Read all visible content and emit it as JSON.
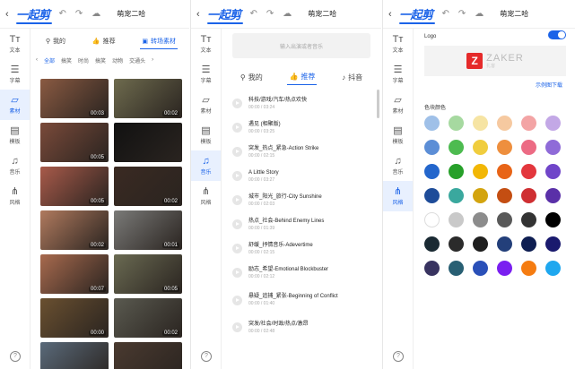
{
  "common": {
    "app_logo": "一起剪",
    "title": "萌宠二哈",
    "sidebar": [
      "文本",
      "字幕",
      "素材",
      "模板",
      "音乐",
      "风格"
    ]
  },
  "material_panel": {
    "tabs": [
      "我的",
      "推荐",
      "转场素材"
    ],
    "subtabs": [
      "全部",
      "搞笑",
      "时尚",
      "搞笑",
      "动物",
      "交通头"
    ],
    "durations": [
      "00:03",
      "00:02",
      "00:05",
      "",
      "00:05",
      "00:02",
      "00:02",
      "00:01",
      "00:07",
      "00:05",
      "00:00",
      "00:02",
      "",
      ""
    ]
  },
  "music_panel": {
    "search_placeholder": "输入出演或者音乐",
    "tabs": [
      "我的",
      "推荐",
      "抖音"
    ],
    "tracks": [
      {
        "name": "科技/游戏/汽车/热点欢快",
        "time": "00:00 / 03:24"
      },
      {
        "name": "遇见 (相聚版)",
        "time": "00:00 / 03:25"
      },
      {
        "name": "突发_热点_紧急-Action Strike",
        "time": "00:00 / 02:15"
      },
      {
        "name": "A Little Story",
        "time": "00:00 / 03:27"
      },
      {
        "name": "城市_阳光_旅行-City Sunshine",
        "time": "00:00 / 02:03"
      },
      {
        "name": "热点_社会-Behind Enemy Lines",
        "time": "00:00 / 01:39"
      },
      {
        "name": "舒缓_抒情音乐-Adevertime",
        "time": "00:00 / 02:15"
      },
      {
        "name": "励志_希望-Emotional Blockbuster",
        "time": "00:00 / 02:12"
      },
      {
        "name": "悬疑_追捕_紧张-Beginning of Conflict",
        "time": "00:00 / 01:40"
      },
      {
        "name": "突发/社会/时政/热点/激昂",
        "time": "00:00 / 02:48"
      }
    ]
  },
  "style_panel": {
    "logo_label": "Logo",
    "logo_name": "ZAKER",
    "logo_sub": "扎客",
    "logo_link": "示例图下载",
    "color_label": "色块颜色",
    "colors": [
      [
        "#9fc0e8",
        "#a6d9a0",
        "#f6e4a3",
        "#f6c9a0",
        "#f3a4a5",
        "#c3a8e6"
      ],
      [
        "#5c8ed6",
        "#4dbb50",
        "#f0cd3e",
        "#ee8f3e",
        "#ec6b84",
        "#8f6bd8"
      ],
      [
        "#2366cc",
        "#27a02a",
        "#f2b705",
        "#e86417",
        "#e3373d",
        "#7045c9"
      ],
      [
        "#1e4c99",
        "#3aa89e",
        "#d3a40f",
        "#c44e12",
        "#cf2f32",
        "#5a30a8"
      ],
      [
        "#ffffff",
        "#c9c9c9",
        "#8c8c8c",
        "#595959",
        "#333333",
        "#000000"
      ],
      [
        "#1a2a33",
        "#2b2b2b",
        "#1f1f1f",
        "#233f7a",
        "#0e1e52",
        "#1a1a6e"
      ],
      [
        "#383360",
        "#285f73",
        "#2a50b8",
        "#7a1ff0",
        "#f57c11",
        "#1ea7ef"
      ]
    ]
  }
}
